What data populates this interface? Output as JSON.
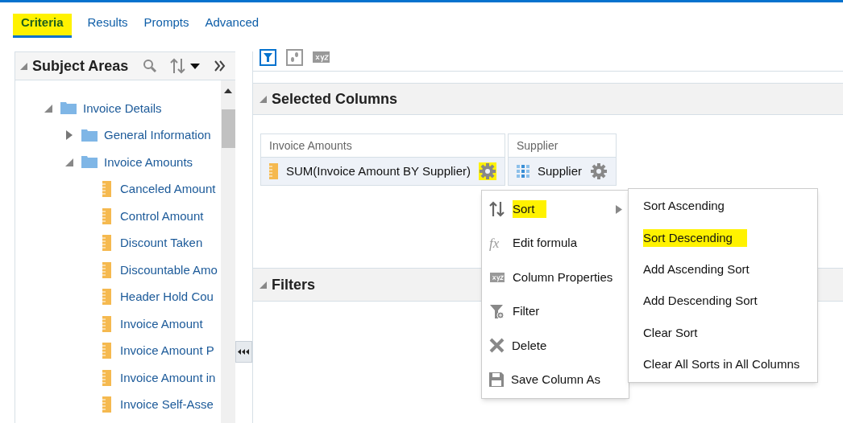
{
  "tabs": [
    {
      "label": "Criteria",
      "selected": true,
      "highlighted": true
    },
    {
      "label": "Results",
      "selected": false,
      "highlighted": false
    },
    {
      "label": "Prompts",
      "selected": false,
      "highlighted": false
    },
    {
      "label": "Advanced",
      "selected": false,
      "highlighted": false
    }
  ],
  "subject_areas": {
    "title": "Subject Areas",
    "tree": [
      {
        "label": "Invoice Details",
        "kind": "folder",
        "expanded": true,
        "children": [
          {
            "label": "General Information",
            "kind": "folder",
            "expanded": false
          },
          {
            "label": "Invoice Amounts",
            "kind": "folder",
            "expanded": true,
            "children": [
              {
                "label": "Canceled Amount",
                "kind": "measure"
              },
              {
                "label": "Control Amount",
                "kind": "measure"
              },
              {
                "label": "Discount Taken",
                "kind": "measure"
              },
              {
                "label": "Discountable Amo",
                "kind": "measure"
              },
              {
                "label": "Header Hold Cou",
                "kind": "measure"
              },
              {
                "label": "Invoice Amount",
                "kind": "measure"
              },
              {
                "label": "Invoice Amount P",
                "kind": "measure"
              },
              {
                "label": "Invoice Amount in",
                "kind": "measure"
              },
              {
                "label": "Invoice Self-Asse",
                "kind": "measure"
              }
            ]
          }
        ]
      }
    ]
  },
  "selected_columns": {
    "title": "Selected Columns",
    "columns": [
      {
        "heading": "Invoice Amounts",
        "value": "SUM(Invoice Amount BY Supplier)",
        "kind": "measure",
        "highlighted": true
      },
      {
        "heading": "Supplier",
        "value": "Supplier",
        "kind": "attribute",
        "highlighted": false
      }
    ]
  },
  "filters": {
    "title": "Filters"
  },
  "context_menu": {
    "items": [
      {
        "label": "Sort",
        "kind": "sort",
        "has_submenu": true,
        "highlighted": true
      },
      {
        "label": "Edit formula",
        "kind": "formula",
        "icon_text": "fx",
        "has_submenu": false,
        "highlighted": false
      },
      {
        "label": "Column Properties",
        "kind": "properties",
        "has_submenu": false,
        "highlighted": false
      },
      {
        "label": "Filter",
        "kind": "filter",
        "has_submenu": false,
        "highlighted": false
      },
      {
        "label": "Delete",
        "kind": "delete",
        "has_submenu": false,
        "highlighted": false
      },
      {
        "label": "Save Column As",
        "kind": "save",
        "has_submenu": false,
        "highlighted": false
      }
    ]
  },
  "submenu": {
    "items": [
      {
        "label": "Sort Ascending",
        "highlighted": false
      },
      {
        "label": "Sort Descending",
        "highlighted": true
      },
      {
        "label": "Add Ascending Sort",
        "highlighted": false
      },
      {
        "label": "Add Descending Sort",
        "highlighted": false
      },
      {
        "label": "Clear Sort",
        "highlighted": false
      },
      {
        "label": "Clear All Sorts in All Columns",
        "highlighted": false
      }
    ]
  }
}
